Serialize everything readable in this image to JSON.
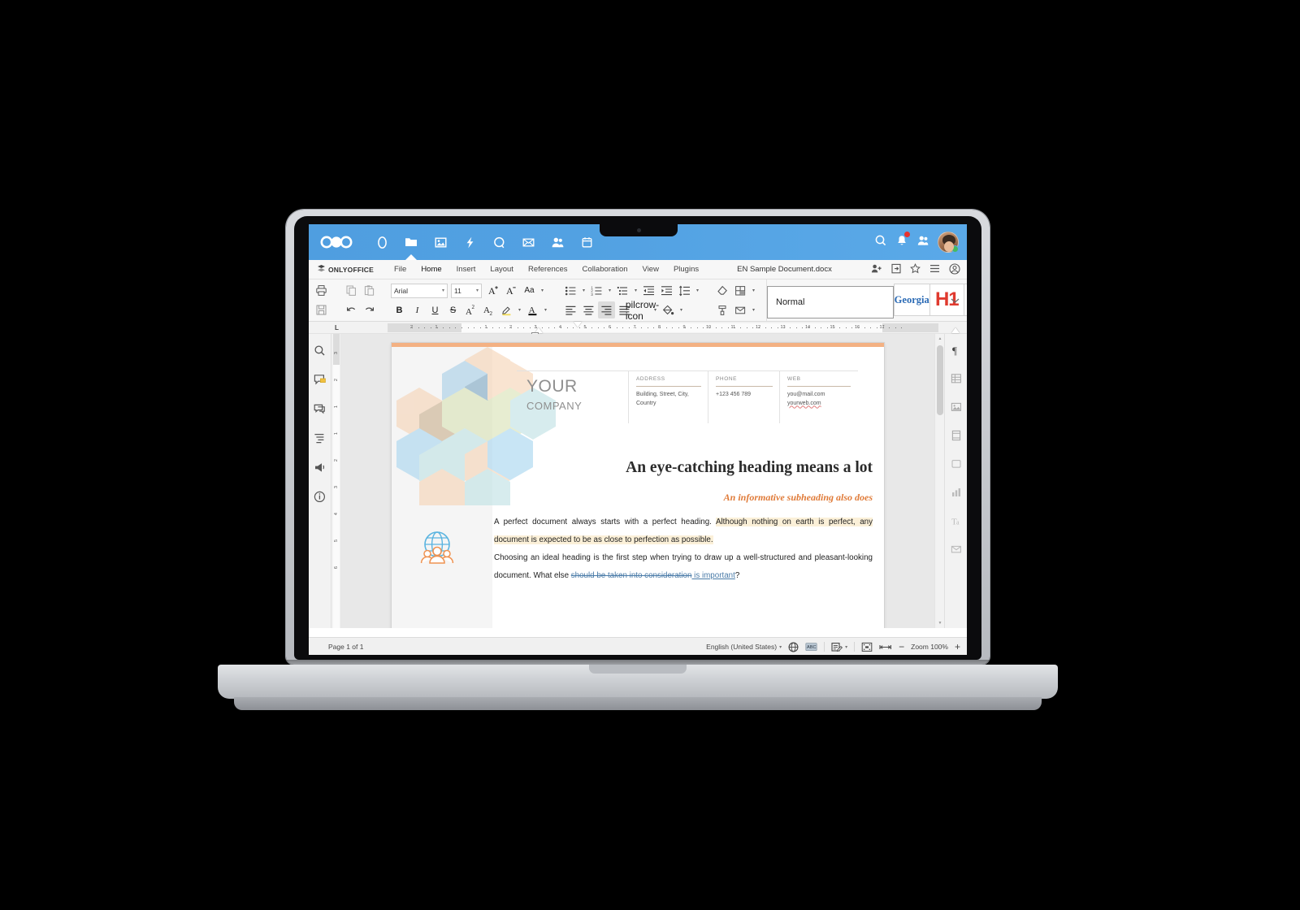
{
  "nextcloud_bar": {
    "logo_name": "nextcloud-logo",
    "apps": [
      {
        "name": "dashboard",
        "icon": "circle-icon",
        "active": false
      },
      {
        "name": "files",
        "icon": "folder-icon",
        "active": true
      },
      {
        "name": "photos",
        "icon": "photos-icon",
        "active": false
      },
      {
        "name": "activity",
        "icon": "lightning-icon",
        "active": false
      },
      {
        "name": "search-app",
        "icon": "q-letter-icon",
        "active": false
      },
      {
        "name": "mail",
        "icon": "envelope-icon",
        "active": false
      },
      {
        "name": "contacts",
        "icon": "contacts-icon",
        "active": false
      },
      {
        "name": "calendar",
        "icon": "calendar-icon",
        "active": false
      }
    ],
    "right_actions": [
      {
        "name": "search",
        "icon": "magnifier-icon"
      },
      {
        "name": "notifications",
        "icon": "bell-icon",
        "badge": true
      },
      {
        "name": "contacts-menu",
        "icon": "person-icon"
      },
      {
        "name": "user-avatar",
        "icon": "avatar-icon",
        "online": true
      }
    ]
  },
  "app_menu": {
    "brand": "ONLYOFFICE",
    "tabs": [
      {
        "label": "File",
        "active": false
      },
      {
        "label": "Home",
        "active": true
      },
      {
        "label": "Insert",
        "active": false
      },
      {
        "label": "Layout",
        "active": false
      },
      {
        "label": "References",
        "active": false
      },
      {
        "label": "Collaboration",
        "active": false
      },
      {
        "label": "View",
        "active": false
      },
      {
        "label": "Plugins",
        "active": false
      }
    ],
    "document_name": "EN Sample Document.docx",
    "right_icons": [
      {
        "name": "share-add-user-icon"
      },
      {
        "name": "open-location-icon"
      },
      {
        "name": "favorite-star-icon"
      },
      {
        "name": "hamburger-menu-icon"
      },
      {
        "name": "user-account-icon"
      }
    ]
  },
  "toolbar": {
    "print_label": "print-icon",
    "save_label": "save-icon",
    "copy_label": "copy-icon",
    "paste_label": "paste-icon",
    "undo_label": "undo-icon",
    "redo_label": "redo-icon",
    "font_family": "Arial",
    "font_size": "11",
    "increase_font": "A",
    "decrease_font": "A",
    "change_case": "Aa",
    "bold": "B",
    "italic": "I",
    "underline": "U",
    "strikethrough": "S",
    "superscript": "A",
    "subscript": "A",
    "highlight": "highlight-color-icon",
    "font_color": "A",
    "bullets": "bullet-list-icon",
    "numbering": "numbered-list-icon",
    "multilevel": "multilevel-list-icon",
    "decrease_indent": "decrease-indent-icon",
    "increase_indent": "increase-indent-icon",
    "line_spacing": "line-spacing-icon",
    "align_left": "align-left-icon",
    "align_center": "align-center-icon",
    "align_right": "align-right-icon",
    "align_justify": "align-justify-icon",
    "nonprinting": "pilcrow-icon",
    "shading": "paint-bucket-icon",
    "clear_style": "clear-style-icon",
    "copy_style": "copy-style-icon",
    "insert_table": "insert-table-icon",
    "mail_merge": "mail-merge-icon",
    "expand_ribbon": "chevron-down-icon",
    "styles": [
      {
        "name": "normal",
        "label": "Normal",
        "selected": true
      },
      {
        "name": "georgia",
        "label": "Georgia",
        "selected": false
      },
      {
        "name": "h1",
        "label": "H1",
        "selected": false
      },
      {
        "name": "blank",
        "label": "",
        "selected": false
      }
    ]
  },
  "ruler": {
    "tab_stop_label": "L",
    "left_ticks": [
      "2",
      "1"
    ],
    "ticks": [
      "1",
      "2",
      "3",
      "4",
      "5",
      "6",
      "7",
      "8",
      "9",
      "10",
      "11",
      "12",
      "13",
      "14",
      "15",
      "16",
      "17"
    ]
  },
  "vertical_ruler": {
    "ticks": [
      "3",
      "2",
      "1",
      "1",
      "2",
      "3",
      "4",
      "5",
      "6"
    ]
  },
  "left_rail": [
    {
      "name": "search-panel",
      "icon": "magnifier-icon"
    },
    {
      "name": "comments-panel",
      "icon": "comment-icon",
      "badge": true
    },
    {
      "name": "chat-panel",
      "icon": "chat-icon"
    },
    {
      "name": "headings-panel",
      "icon": "navigation-icon"
    },
    {
      "name": "feedback-panel",
      "icon": "megaphone-icon"
    },
    {
      "name": "about-panel",
      "icon": "info-icon"
    }
  ],
  "right_rail": [
    {
      "name": "paragraph-settings",
      "icon": "pilcrow-icon"
    },
    {
      "name": "table-settings",
      "icon": "table-icon"
    },
    {
      "name": "image-settings",
      "icon": "image-icon"
    },
    {
      "name": "header-footer",
      "icon": "header-footer-icon"
    },
    {
      "name": "shape-settings",
      "icon": "shape-icon"
    },
    {
      "name": "chart-settings",
      "icon": "chart-icon"
    },
    {
      "name": "text-art-settings",
      "icon": "text-art-icon"
    },
    {
      "name": "signature-settings",
      "icon": "signature-icon"
    }
  ],
  "document": {
    "letterhead": {
      "company_line1": "YOUR",
      "company_line2": "COMPANY",
      "columns": [
        {
          "header": "ADDRESS",
          "lines": [
            "Building, Street, City,",
            "Country"
          ]
        },
        {
          "header": "PHONE",
          "lines": [
            "+123 456 789"
          ]
        },
        {
          "header": "WEB",
          "lines": [
            "you@mail.com",
            "yourweb.com"
          ]
        }
      ]
    },
    "heading": "An eye-catching heading means a lot",
    "subheading": "An informative subheading also does",
    "paragraph1_plain": "A perfect document always starts with a perfect heading. ",
    "paragraph1_highlight": "Although nothing on earth is perfect, any document is expected to be as close to perfection as possible.",
    "paragraph2_plain": "Choosing an ideal heading is the first step when trying to draw up a well-structured and pleasant-looking document. What else ",
    "paragraph2_deleted": "should be taken into consideration",
    "paragraph2_inserted": " is important",
    "paragraph2_tail": "?",
    "globe_icon": "globe-people-icon"
  },
  "status_bar": {
    "page_indicator": "Page 1 of 1",
    "language": "English (United States)",
    "language_caret": "chevron-down-icon",
    "set_language_icon": "globe-icon",
    "spellcheck_icon": "spellcheck-abc-icon",
    "track_changes_icon": "track-changes-icon",
    "track_changes_caret": "chevron-down-icon",
    "fit_page_icon": "fit-page-icon",
    "fit_width_icon": "fit-width-icon",
    "zoom_out": "−",
    "zoom_label": "Zoom 100%",
    "zoom_in": "+"
  },
  "colors": {
    "nextcloud_blue": "#52a1e2",
    "accent_orange": "#e07b39",
    "page_topbar": "#f3b183",
    "highlight_yellow": "#fbf0d8",
    "revision_blue": "#4a7ba8",
    "h1_red": "#e03a2f",
    "georgia_blue": "#2a6ab5",
    "notification_red": "#e9322d"
  }
}
